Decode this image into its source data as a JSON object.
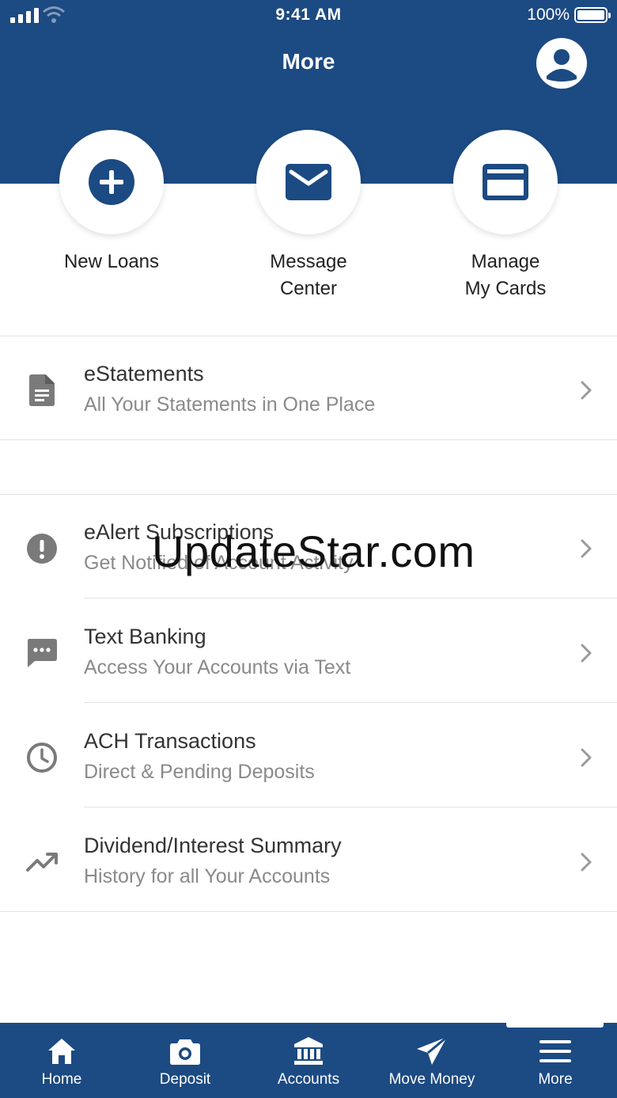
{
  "status_bar": {
    "time": "9:41 AM",
    "battery": "100%"
  },
  "header": {
    "title": "More"
  },
  "quick_actions": [
    {
      "label": "New Loans",
      "icon": "plus-circle-icon"
    },
    {
      "label": "Message\nCenter",
      "icon": "envelope-icon"
    },
    {
      "label": "Manage\nMy Cards",
      "icon": "credit-card-icon"
    }
  ],
  "menu": [
    {
      "title": "eStatements",
      "subtitle": "All Your Statements in One Place",
      "icon": "document-icon"
    },
    {
      "title": "eAlert Subscriptions",
      "subtitle": "Get Notified of Account Activity",
      "icon": "alert-icon"
    },
    {
      "title": "Text Banking",
      "subtitle": "Access Your Accounts via Text",
      "icon": "chat-icon"
    },
    {
      "title": "ACH Transactions",
      "subtitle": "Direct & Pending Deposits",
      "icon": "clock-icon"
    },
    {
      "title": "Dividend/Interest Summary",
      "subtitle": "History for all Your Accounts",
      "icon": "trending-up-icon"
    }
  ],
  "watermark": "UpdateStar.com",
  "tabs": [
    {
      "label": "Home",
      "icon": "home-icon"
    },
    {
      "label": "Deposit",
      "icon": "camera-icon"
    },
    {
      "label": "Accounts",
      "icon": "bank-icon"
    },
    {
      "label": "Move Money",
      "icon": "send-icon"
    },
    {
      "label": "More",
      "icon": "menu-icon"
    }
  ],
  "colors": {
    "brand": "#1c4a82",
    "icon_gray": "#7a7a7a",
    "subtitle_gray": "#8a8a8a"
  }
}
